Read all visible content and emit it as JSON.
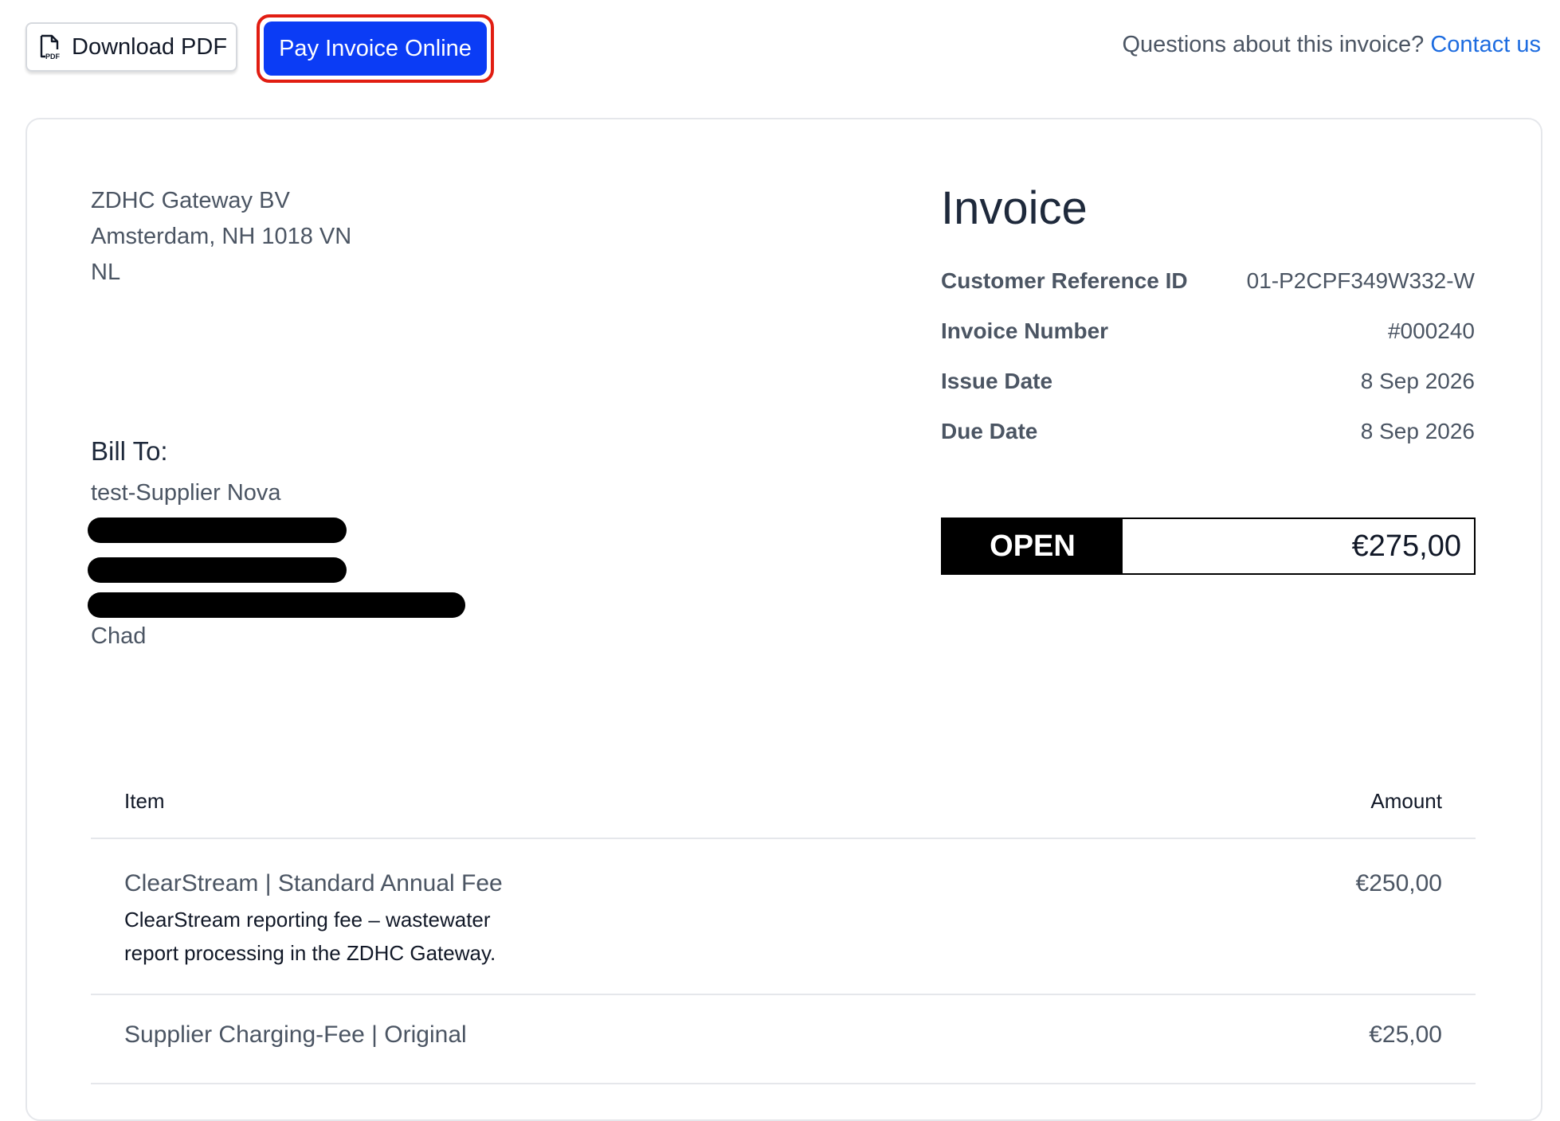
{
  "toolbar": {
    "download_label": "Download PDF",
    "pay_label": "Pay Invoice Online",
    "questions_text": "Questions about this invoice?",
    "contact_label": "Contact us"
  },
  "sender": {
    "name": "ZDHC Gateway BV",
    "address": "Amsterdam, NH 1018 VN",
    "country": "NL"
  },
  "bill_to": {
    "title": "Bill To:",
    "name": "test-Supplier Nova",
    "country": "Chad"
  },
  "invoice": {
    "title": "Invoice",
    "meta": [
      {
        "label": "Customer Reference ID",
        "value": "01-P2CPF349W332-W"
      },
      {
        "label": "Invoice Number",
        "value": "#000240"
      },
      {
        "label": "Issue Date",
        "value": "8 Sep 2026"
      },
      {
        "label": "Due Date",
        "value": "8 Sep 2026"
      }
    ],
    "status": "OPEN",
    "total": "€275,00"
  },
  "items": {
    "header_item": "Item",
    "header_amount": "Amount",
    "rows": [
      {
        "name": "ClearStream | Standard Annual Fee",
        "description": "ClearStream reporting fee – wastewater report processing in the ZDHC Gateway.",
        "amount": "€250,00"
      },
      {
        "name": "Supplier Charging-Fee | Original",
        "description": "",
        "amount": "€25,00"
      }
    ]
  },
  "colors": {
    "pay_button": "#0b3cf5",
    "focus_ring": "#e11d12",
    "link": "#1d6ce0",
    "status_bg": "#000000"
  },
  "icons": {
    "download": "pdf-file-icon"
  }
}
